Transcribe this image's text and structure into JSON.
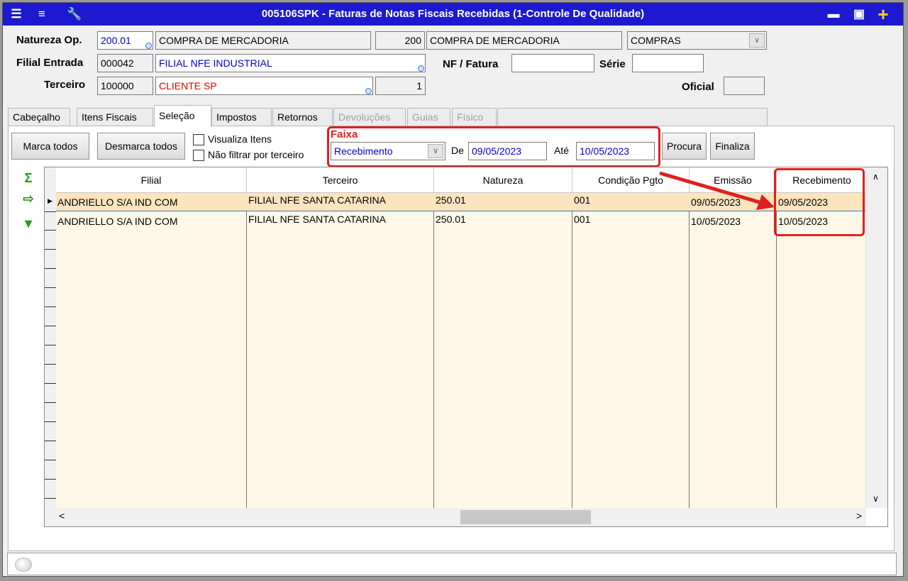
{
  "window": {
    "title": "005106SPK - Faturas de Notas Fiscais Recebidas (1-Controle De Qualidade)"
  },
  "header": {
    "natureza_label": "Natureza Op.",
    "natureza_code": "200.01",
    "natureza_desc": "COMPRA DE MERCADORIA",
    "natureza_code2": "200",
    "natureza_desc2": "COMPRA DE MERCADORIA",
    "natureza_type": "COMPRAS",
    "filial_label": "Filial Entrada",
    "filial_code": "000042",
    "filial_name": "FILIAL NFE INDUSTRIAL",
    "nf_label": "NF / Fatura",
    "nf_value": "",
    "serie_label": "Série",
    "serie_value": "",
    "terceiro_label": "Terceiro",
    "terceiro_code": "100000",
    "terceiro_name": "CLIENTE SP",
    "terceiro_num": "1",
    "oficial_label": "Oficial",
    "oficial_value": ""
  },
  "tabs": [
    "Cabeçalho",
    "Itens Fiscais",
    "Seleção",
    "Impostos",
    "Retornos",
    "Devoluções",
    "Guias",
    "Físico"
  ],
  "selection": {
    "mark_all": "Marca todos",
    "unmark_all": "Desmarca todos",
    "view_items": "Visualiza Itens",
    "no_filter": "Não filtrar por terceiro",
    "faixa_label": "Faixa",
    "faixa_value": "Recebimento",
    "de_label": "De",
    "de_value": "09/05/2023",
    "ate_label": "Até",
    "ate_value": "10/05/2023",
    "search": "Procura",
    "finish": "Finaliza"
  },
  "icons": {
    "sum": "sigma-icon",
    "export": "export-icon",
    "expand": "expand-down-icon"
  },
  "colors": {
    "title_bar": "#1c19d0",
    "highlight": "#e02020",
    "grid_bg": "#fff8e8",
    "selected_row": "#fbe4be"
  },
  "grid": {
    "columns": [
      "Filial",
      "Terceiro",
      "Natureza",
      "Condição Pgto",
      "Emissão",
      "Recebimento"
    ],
    "rows": [
      [
        "ANDRIELLO S/A IND COM",
        "FILIAL NFE SANTA CATARINA",
        "250.01",
        "001",
        "09/05/2023",
        "09/05/2023"
      ],
      [
        "ANDRIELLO S/A IND COM",
        "FILIAL NFE SANTA CATARINA",
        "250.01",
        "001",
        "10/05/2023",
        "10/05/2023"
      ]
    ]
  }
}
